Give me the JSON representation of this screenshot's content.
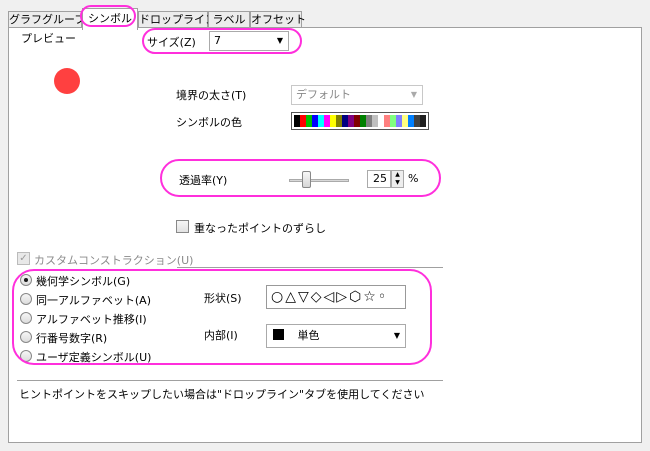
{
  "tabs": [
    {
      "label": "グラフグループ"
    },
    {
      "label": "シンボル"
    },
    {
      "label": "ドロップライン"
    },
    {
      "label": "ラベル"
    },
    {
      "label": "オフセット"
    }
  ],
  "preview": {
    "label": "プレビュー",
    "symbol_color": "#ff4040"
  },
  "size": {
    "label": "サイズ(Z)",
    "value": "7"
  },
  "border_width": {
    "label": "境界の太さ(T)",
    "value": "デフォルト"
  },
  "symbol_color": {
    "label": "シンボルの色",
    "swatches": [
      "#000000",
      "#ff0000",
      "#00c000",
      "#0000ff",
      "#00ffff",
      "#ff00ff",
      "#ffff00",
      "#808000",
      "#000080",
      "#800080",
      "#800000",
      "#008000",
      "#808080",
      "#c0c0c0",
      "#ffffff",
      "#ff8080",
      "#80ff80",
      "#8080ff",
      "#ffff80",
      "#0080ff",
      "#404040",
      "#202020"
    ]
  },
  "transparency": {
    "label": "透過率(Y)",
    "value": "25",
    "unit": "%",
    "level": 25
  },
  "offset_overlap": {
    "label": "重なったポイントのずらし",
    "checked": false
  },
  "custom_construction": {
    "label": "カスタムコンストラクション(U)",
    "checked": true,
    "enabled": false
  },
  "symbol_types": [
    {
      "label": "幾何学シンボル(G)",
      "selected": true
    },
    {
      "label": "同一アルファベット(A)",
      "selected": false
    },
    {
      "label": "アルファベット推移(I)",
      "selected": false
    },
    {
      "label": "行番号数字(R)",
      "selected": false
    },
    {
      "label": "ユーザ定義シンボル(U)",
      "selected": false
    }
  ],
  "shape": {
    "label": "形状(S)",
    "glyphs": "○△▽◇◁▷⬡☆◦"
  },
  "interior": {
    "label": "内部(I)",
    "value": "単色"
  },
  "hint": "ヒントポイントをスキップしたい場合は\"ドロップライン\"タブを使用してください",
  "colors": {
    "highlight": "#ff2fdc"
  }
}
